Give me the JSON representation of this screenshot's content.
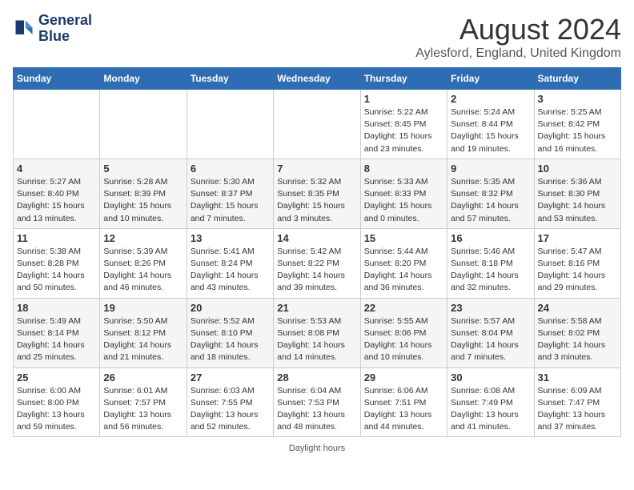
{
  "header": {
    "logo_line1": "General",
    "logo_line2": "Blue",
    "title": "August 2024",
    "subtitle": "Aylesford, England, United Kingdom"
  },
  "days_of_week": [
    "Sunday",
    "Monday",
    "Tuesday",
    "Wednesday",
    "Thursday",
    "Friday",
    "Saturday"
  ],
  "weeks": [
    [
      {
        "num": "",
        "detail": ""
      },
      {
        "num": "",
        "detail": ""
      },
      {
        "num": "",
        "detail": ""
      },
      {
        "num": "",
        "detail": ""
      },
      {
        "num": "1",
        "detail": "Sunrise: 5:22 AM\nSunset: 8:45 PM\nDaylight: 15 hours\nand 23 minutes."
      },
      {
        "num": "2",
        "detail": "Sunrise: 5:24 AM\nSunset: 8:44 PM\nDaylight: 15 hours\nand 19 minutes."
      },
      {
        "num": "3",
        "detail": "Sunrise: 5:25 AM\nSunset: 8:42 PM\nDaylight: 15 hours\nand 16 minutes."
      }
    ],
    [
      {
        "num": "4",
        "detail": "Sunrise: 5:27 AM\nSunset: 8:40 PM\nDaylight: 15 hours\nand 13 minutes."
      },
      {
        "num": "5",
        "detail": "Sunrise: 5:28 AM\nSunset: 8:39 PM\nDaylight: 15 hours\nand 10 minutes."
      },
      {
        "num": "6",
        "detail": "Sunrise: 5:30 AM\nSunset: 8:37 PM\nDaylight: 15 hours\nand 7 minutes."
      },
      {
        "num": "7",
        "detail": "Sunrise: 5:32 AM\nSunset: 8:35 PM\nDaylight: 15 hours\nand 3 minutes."
      },
      {
        "num": "8",
        "detail": "Sunrise: 5:33 AM\nSunset: 8:33 PM\nDaylight: 15 hours\nand 0 minutes."
      },
      {
        "num": "9",
        "detail": "Sunrise: 5:35 AM\nSunset: 8:32 PM\nDaylight: 14 hours\nand 57 minutes."
      },
      {
        "num": "10",
        "detail": "Sunrise: 5:36 AM\nSunset: 8:30 PM\nDaylight: 14 hours\nand 53 minutes."
      }
    ],
    [
      {
        "num": "11",
        "detail": "Sunrise: 5:38 AM\nSunset: 8:28 PM\nDaylight: 14 hours\nand 50 minutes."
      },
      {
        "num": "12",
        "detail": "Sunrise: 5:39 AM\nSunset: 8:26 PM\nDaylight: 14 hours\nand 46 minutes."
      },
      {
        "num": "13",
        "detail": "Sunrise: 5:41 AM\nSunset: 8:24 PM\nDaylight: 14 hours\nand 43 minutes."
      },
      {
        "num": "14",
        "detail": "Sunrise: 5:42 AM\nSunset: 8:22 PM\nDaylight: 14 hours\nand 39 minutes."
      },
      {
        "num": "15",
        "detail": "Sunrise: 5:44 AM\nSunset: 8:20 PM\nDaylight: 14 hours\nand 36 minutes."
      },
      {
        "num": "16",
        "detail": "Sunrise: 5:46 AM\nSunset: 8:18 PM\nDaylight: 14 hours\nand 32 minutes."
      },
      {
        "num": "17",
        "detail": "Sunrise: 5:47 AM\nSunset: 8:16 PM\nDaylight: 14 hours\nand 29 minutes."
      }
    ],
    [
      {
        "num": "18",
        "detail": "Sunrise: 5:49 AM\nSunset: 8:14 PM\nDaylight: 14 hours\nand 25 minutes."
      },
      {
        "num": "19",
        "detail": "Sunrise: 5:50 AM\nSunset: 8:12 PM\nDaylight: 14 hours\nand 21 minutes."
      },
      {
        "num": "20",
        "detail": "Sunrise: 5:52 AM\nSunset: 8:10 PM\nDaylight: 14 hours\nand 18 minutes."
      },
      {
        "num": "21",
        "detail": "Sunrise: 5:53 AM\nSunset: 8:08 PM\nDaylight: 14 hours\nand 14 minutes."
      },
      {
        "num": "22",
        "detail": "Sunrise: 5:55 AM\nSunset: 8:06 PM\nDaylight: 14 hours\nand 10 minutes."
      },
      {
        "num": "23",
        "detail": "Sunrise: 5:57 AM\nSunset: 8:04 PM\nDaylight: 14 hours\nand 7 minutes."
      },
      {
        "num": "24",
        "detail": "Sunrise: 5:58 AM\nSunset: 8:02 PM\nDaylight: 14 hours\nand 3 minutes."
      }
    ],
    [
      {
        "num": "25",
        "detail": "Sunrise: 6:00 AM\nSunset: 8:00 PM\nDaylight: 13 hours\nand 59 minutes."
      },
      {
        "num": "26",
        "detail": "Sunrise: 6:01 AM\nSunset: 7:57 PM\nDaylight: 13 hours\nand 56 minutes."
      },
      {
        "num": "27",
        "detail": "Sunrise: 6:03 AM\nSunset: 7:55 PM\nDaylight: 13 hours\nand 52 minutes."
      },
      {
        "num": "28",
        "detail": "Sunrise: 6:04 AM\nSunset: 7:53 PM\nDaylight: 13 hours\nand 48 minutes."
      },
      {
        "num": "29",
        "detail": "Sunrise: 6:06 AM\nSunset: 7:51 PM\nDaylight: 13 hours\nand 44 minutes."
      },
      {
        "num": "30",
        "detail": "Sunrise: 6:08 AM\nSunset: 7:49 PM\nDaylight: 13 hours\nand 41 minutes."
      },
      {
        "num": "31",
        "detail": "Sunrise: 6:09 AM\nSunset: 7:47 PM\nDaylight: 13 hours\nand 37 minutes."
      }
    ]
  ],
  "footer": "Daylight hours"
}
